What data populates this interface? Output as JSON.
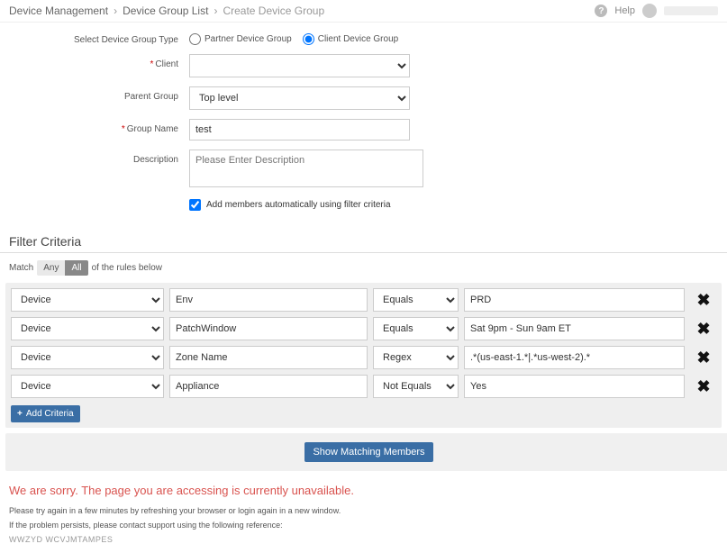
{
  "breadcrumb": {
    "items": [
      "Device Management",
      "Device Group List",
      "Create Device Group"
    ]
  },
  "header": {
    "help_label": "Help"
  },
  "form": {
    "group_type_label": "Select Device Group Type",
    "group_type_options": {
      "partner": "Partner Device Group",
      "client": "Client Device Group"
    },
    "group_type_selected": "client",
    "client_label": "Client",
    "client_value": "",
    "parent_group_label": "Parent Group",
    "parent_group_value": "Top level",
    "group_name_label": "Group Name",
    "group_name_value": "test",
    "description_label": "Description",
    "description_placeholder": "Please Enter Description",
    "description_value": "",
    "auto_members_label": "Add members automatically using filter criteria",
    "auto_members_checked": true
  },
  "filter": {
    "section_title": "Filter Criteria",
    "match_prefix": "Match",
    "match_any": "Any",
    "match_all": "All",
    "match_suffix": "of the rules below",
    "match_selected": "All",
    "rows": [
      {
        "type": "Device",
        "attr": "Env",
        "op": "Equals",
        "val": "PRD"
      },
      {
        "type": "Device",
        "attr": "PatchWindow",
        "op": "Equals",
        "val": "Sat 9pm - Sun 9am ET"
      },
      {
        "type": "Device",
        "attr": "Zone Name",
        "op": "Regex",
        "val": ".*(us-east-1.*|.*us-west-2).*"
      },
      {
        "type": "Device",
        "attr": "Appliance",
        "op": "Not Equals",
        "val": "Yes"
      }
    ],
    "add_criteria_label": "Add Criteria",
    "show_matching_label": "Show Matching Members"
  },
  "error": {
    "title": "We are sorry.  The page you are accessing is currently unavailable.",
    "line1": "Please try again in a few minutes by refreshing your browser or login again in a new window.",
    "line2": "If the problem persists, please contact support using the following reference:",
    "reference": "WWZYD WCVJMTAMPES"
  }
}
